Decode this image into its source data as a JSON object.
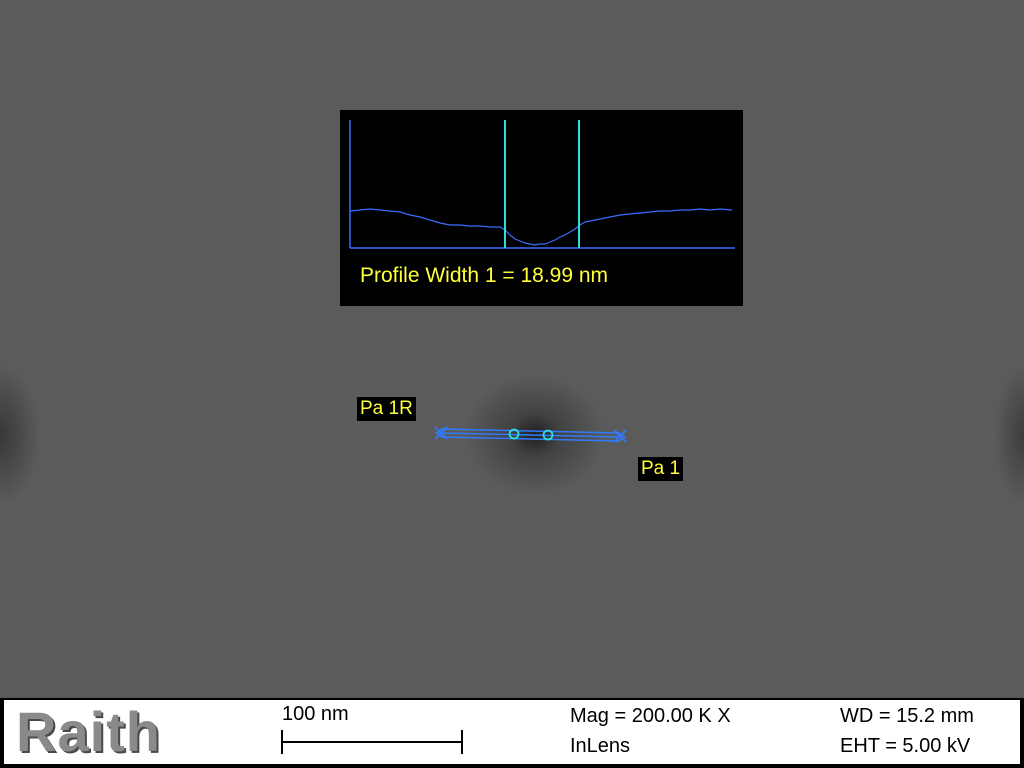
{
  "profile": {
    "label": "Profile Width 1 = 18.99 nm"
  },
  "markers": {
    "right_tag": "Pa 1R",
    "left_tag": "Pa 1"
  },
  "info_bar": {
    "logo": "Raith",
    "scale_bar_label": "100 nm",
    "magnification": "Mag = 200.00 K X",
    "detector": "InLens",
    "working_distance": "WD = 15.2 mm",
    "eht": "EHT =  5.00 kV"
  },
  "colors": {
    "profile_line": "#3a6cff",
    "cursor_lines": "#2de0e0",
    "annotation_text": "#ffff3a",
    "measure_line": "#2f7bff"
  }
}
